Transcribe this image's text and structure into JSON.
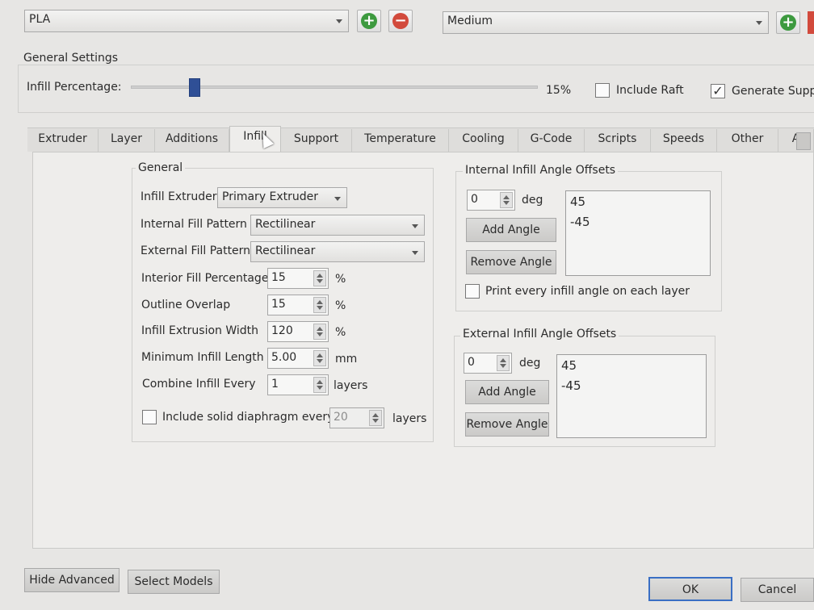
{
  "profiles": {
    "material": "PLA",
    "quality": "Medium"
  },
  "general_settings": {
    "title": "General Settings",
    "infill_label": "Infill Percentage:",
    "infill_value": "15%",
    "infill_fraction": 0.15,
    "include_raft": "Include Raft",
    "include_raft_checked": false,
    "generate_support": "Generate Suppo",
    "generate_support_checked": true
  },
  "tabs": [
    "Extruder",
    "Layer",
    "Additions",
    "Infill",
    "Support",
    "Temperature",
    "Cooling",
    "G-Code",
    "Scripts",
    "Speeds",
    "Other",
    "A"
  ],
  "active_tab": "Infill",
  "infill_general": {
    "title": "General",
    "infill_extruder_label": "Infill Extruder",
    "infill_extruder_value": "Primary Extruder",
    "internal_pattern_label": "Internal Fill Pattern",
    "internal_pattern_value": "Rectilinear",
    "external_pattern_label": "External Fill Pattern",
    "external_pattern_value": "Rectilinear",
    "interior_fill_label": "Interior Fill Percentage",
    "interior_fill_value": "15",
    "interior_fill_unit": "%",
    "outline_overlap_label": "Outline Overlap",
    "outline_overlap_value": "15",
    "outline_overlap_unit": "%",
    "extrusion_width_label": "Infill Extrusion Width",
    "extrusion_width_value": "120",
    "extrusion_width_unit": "%",
    "min_length_label": "Minimum Infill Length",
    "min_length_value": "5.00",
    "min_length_unit": "mm",
    "combine_label": "Combine Infill Every",
    "combine_value": "1",
    "combine_unit": "layers",
    "diaphragm_label": "Include solid diaphragm every",
    "diaphragm_value": "20",
    "diaphragm_unit": "layers",
    "diaphragm_checked": false
  },
  "internal_angles": {
    "title": "Internal Infill Angle Offsets",
    "angle_value": "0",
    "unit": "deg",
    "add_label": "Add Angle",
    "remove_label": "Remove Angle",
    "list": [
      "45",
      "-45"
    ],
    "print_every_label": "Print every infill angle on each layer",
    "print_every_checked": false
  },
  "external_angles": {
    "title": "External Infill Angle Offsets",
    "angle_value": "0",
    "unit": "deg",
    "add_label": "Add Angle",
    "remove_label": "Remove Angle",
    "list": [
      "45",
      "-45"
    ]
  },
  "footer": {
    "hide_advanced": "Hide Advanced",
    "select_models": "Select Models",
    "ok": "OK",
    "cancel": "Cancel"
  }
}
